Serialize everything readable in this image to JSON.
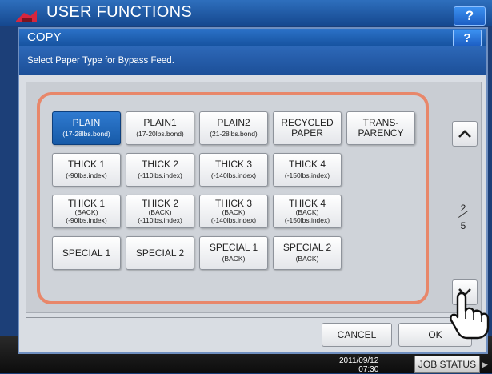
{
  "app": {
    "title": "USER FUNCTIONS",
    "help_label": "?"
  },
  "dialog": {
    "title": "COPY",
    "help_label": "?",
    "message": "Select Paper Type for Bypass Feed."
  },
  "paper_types": [
    {
      "main": "PLAIN",
      "sub": "(17-28lbs.bond)",
      "selected": true
    },
    {
      "main": "PLAIN1",
      "sub": "(17-20lbs.bond)",
      "selected": false
    },
    {
      "main": "PLAIN2",
      "sub": "(21-28lbs.bond)",
      "selected": false
    },
    {
      "main": "RECYCLED\nPAPER",
      "sub": "",
      "selected": false
    },
    {
      "main": "TRANS-\nPARENCY",
      "sub": "",
      "selected": false
    },
    {
      "main": "THICK 1",
      "sub": "(-90lbs.index)",
      "selected": false
    },
    {
      "main": "THICK 2",
      "sub": "(-110lbs.index)",
      "selected": false
    },
    {
      "main": "THICK 3",
      "sub": "(-140lbs.index)",
      "selected": false
    },
    {
      "main": "THICK 4",
      "sub": "(-150lbs.index)",
      "selected": false
    },
    {
      "main": "THICK 1",
      "sub": "(BACK)\n(-90lbs.index)",
      "selected": false
    },
    {
      "main": "THICK 2",
      "sub": "(BACK)\n(-110lbs.index)",
      "selected": false
    },
    {
      "main": "THICK 3",
      "sub": "(BACK)\n(-140lbs.index)",
      "selected": false
    },
    {
      "main": "THICK 4",
      "sub": "(BACK)\n(-150lbs.index)",
      "selected": false
    },
    {
      "main": "SPECIAL 1",
      "sub": "",
      "selected": false
    },
    {
      "main": "SPECIAL 2",
      "sub": "",
      "selected": false
    },
    {
      "main": "SPECIAL 1",
      "sub": "(BACK)",
      "selected": false
    },
    {
      "main": "SPECIAL 2",
      "sub": "(BACK)",
      "selected": false
    }
  ],
  "pager": {
    "current": "2",
    "total": "5"
  },
  "actions": {
    "cancel_label": "CANCEL",
    "ok_label": "OK"
  },
  "status_bar": {
    "date": "2011/09/12",
    "time": "07:30",
    "job_status_label": "JOB STATUS"
  },
  "colors": {
    "accent_blue": "#1d5fc4",
    "selected_button": "#2f7ad0",
    "group_frame": "#e8876a"
  }
}
